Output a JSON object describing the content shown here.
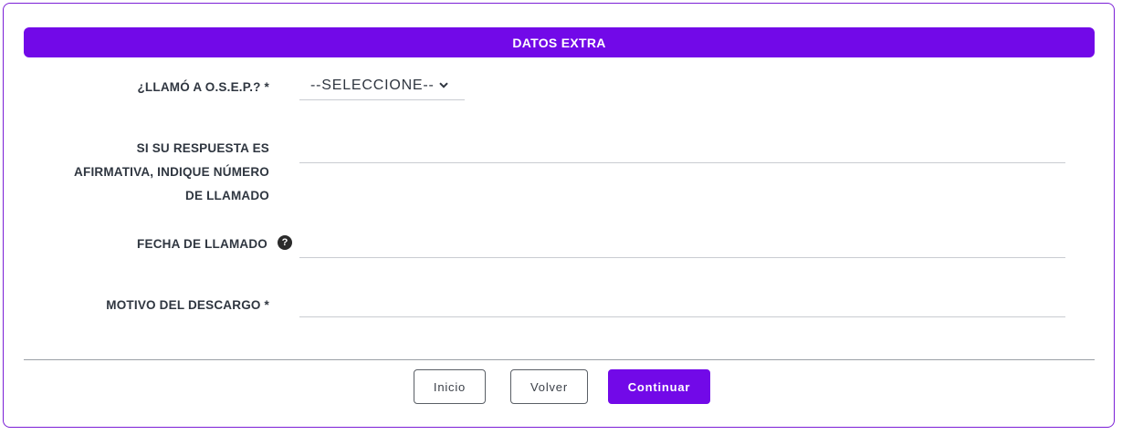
{
  "header": {
    "title": "DATOS EXTRA"
  },
  "fields": {
    "llamo": {
      "label": "¿LLAMÓ A O.S.E.P.? *",
      "selected": "--SELECCIONE--"
    },
    "numero": {
      "label_line1": "SI SU RESPUESTA ES",
      "label_line2": "AFIRMATIVA, INDIQUE NÚMERO",
      "label_line3": "DE LLAMADO",
      "value": ""
    },
    "fecha": {
      "label": "FECHA DE LLAMADO",
      "help_icon": "question-circle-icon",
      "value": ""
    },
    "motivo": {
      "label": "MOTIVO DEL DESCARGO *",
      "value": ""
    }
  },
  "buttons": {
    "inicio": "Inicio",
    "volver": "Volver",
    "continuar": "Continuar"
  },
  "colors": {
    "accent": "#7209e8",
    "border": "#7b1fd6",
    "text": "#2f3640"
  }
}
